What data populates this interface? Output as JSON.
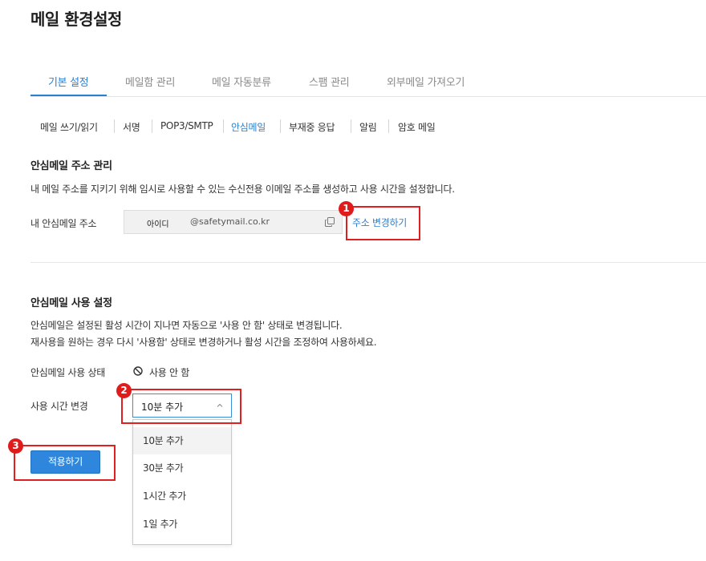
{
  "page": {
    "title": "메일 환경설정"
  },
  "tabs": [
    {
      "label": "기본 설정",
      "active": true
    },
    {
      "label": "메일함 관리",
      "active": false
    },
    {
      "label": "메일 자동분류",
      "active": false
    },
    {
      "label": "스팸 관리",
      "active": false
    },
    {
      "label": "외부메일 가져오기",
      "active": false
    }
  ],
  "subnav": [
    {
      "label": "메일 쓰기/읽기",
      "active": false
    },
    {
      "label": "서명",
      "active": false
    },
    {
      "label": "POP3/SMTP",
      "active": false
    },
    {
      "label": "안심메일",
      "active": true
    },
    {
      "label": "부재중 응답",
      "active": false
    },
    {
      "label": "알림",
      "active": false
    },
    {
      "label": "암호 메일",
      "active": false
    }
  ],
  "address_section": {
    "title": "안심메일 주소 관리",
    "description": "내 메일 주소를 지키기 위해 임시로 사용할 수 있는 수신전용 이메일 주소를 생성하고 사용 시간을 설정합니다.",
    "field_label": "내 안심메일 주소",
    "address_id": "아이디",
    "address_domain": "@safetymail.co.kr",
    "copy_icon": "copy-icon",
    "change_link": "주소 변경하기"
  },
  "usage_section": {
    "title": "안심메일 사용 설정",
    "description_line1": "안심메일은 설정된 활성 시간이 지나면 자동으로 '사용 안 함' 상태로 변경됩니다.",
    "description_line2": "재사용을 원하는 경우 다시 '사용함' 상태로 변경하거나 활성 시간을 조정하여 사용하세요.",
    "status_label": "안심메일 사용 상태",
    "status_icon": "no-entry-icon",
    "status_value": "사용 안 함",
    "time_label": "사용 시간 변경",
    "time_selected": "10분 추가",
    "time_options": [
      "10분 추가",
      "30분 추가",
      "1시간 추가",
      "1일 추가"
    ],
    "apply_button": "적용하기"
  },
  "annotations": {
    "badges": [
      "1",
      "2",
      "3"
    ],
    "color": "#e02020"
  },
  "colors": {
    "accent": "#2b7fd0",
    "button": "#2e87dc"
  }
}
